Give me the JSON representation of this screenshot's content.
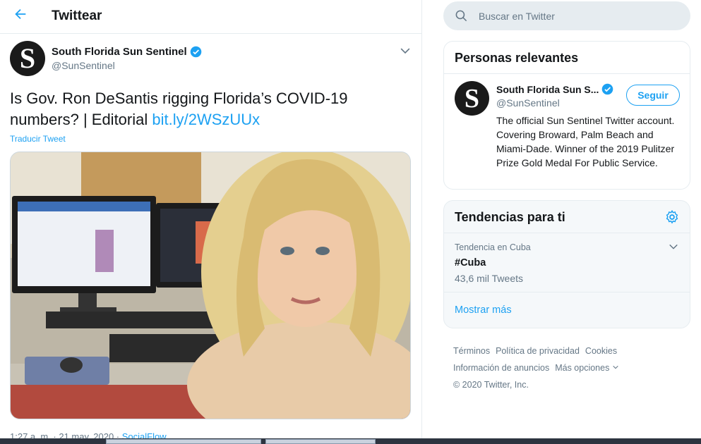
{
  "header": {
    "title": "Twittear"
  },
  "tweet": {
    "author_name": "South Florida Sun Sentinel",
    "author_handle": "@SunSentinel",
    "text": "Is Gov. Ron DeSantis rigging Florida’s COVID-19 numbers? | Editorial ",
    "link": "bit.ly/2WSzUUx",
    "translate_label": "Traducir Tweet",
    "timestamp": "1:27 a. m. · 21 may. 2020 · ",
    "source": "SocialFlow"
  },
  "search": {
    "placeholder": "Buscar en Twitter"
  },
  "relevant": {
    "title": "Personas relevantes",
    "name": "South Florida Sun S...",
    "handle": "@SunSentinel",
    "follow_label": "Seguir",
    "bio": "The official Sun Sentinel Twitter account. Covering Broward, Palm Beach and Miami-Dade. Winner of the 2019 Pulitzer Prize Gold Medal For Public Service."
  },
  "trends": {
    "title": "Tendencias para ti",
    "items": [
      {
        "category": "Tendencia en Cuba",
        "name": "#Cuba",
        "count": "43,6 mil Tweets"
      }
    ],
    "more_label": "Mostrar más"
  },
  "footer": {
    "links": [
      "Términos",
      "Política de privacidad",
      "Cookies",
      "Información de anuncios",
      "Más opciones"
    ],
    "copyright": "© 2020 Twitter, Inc."
  },
  "colors": {
    "accent": "#1da1f2",
    "secondary_text": "#657786",
    "border": "#e6ecf0"
  },
  "icons": [
    "back-arrow-icon",
    "verified-icon",
    "chevron-down-icon",
    "search-icon",
    "gear-icon",
    "avatar-logo-icon"
  ]
}
